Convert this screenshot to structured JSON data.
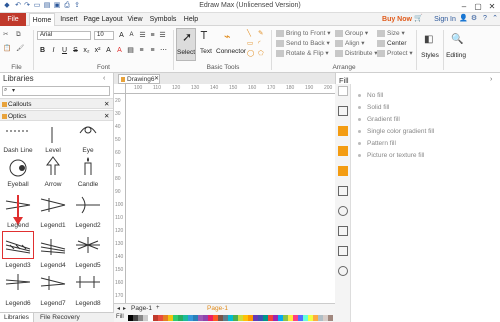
{
  "window": {
    "title": "Edraw Max (Unlicensed Version)"
  },
  "menu": {
    "tabs": [
      "File",
      "Home",
      "Insert",
      "Page Layout",
      "View",
      "Symbols",
      "Help"
    ],
    "buy_now": "Buy Now",
    "sign_in": "Sign In"
  },
  "ribbon": {
    "font_name": "Arial",
    "font_size": "10",
    "group_file": "File",
    "group_font": "Font",
    "group_basic_tools": "Basic Tools",
    "group_arrange": "Arrange",
    "select_label": "Select",
    "text_label": "Text",
    "connector_label": "Connector",
    "bring_to_front": "Bring to Front",
    "send_to_back": "Send to Back",
    "rotate_flip": "Rotate & Flip",
    "group": "Group",
    "align": "Align",
    "distribute": "Distribute",
    "size": "Size",
    "center": "Center",
    "protect": "Protect",
    "styles": "Styles",
    "editing": "Editing"
  },
  "libraries": {
    "title": "Libraries",
    "categories": [
      "Callouts",
      "Optics"
    ],
    "shapes": [
      [
        "Dash Line",
        "Level",
        "Eye"
      ],
      [
        "Eyeball",
        "Arrow",
        "Candle"
      ],
      [
        "Legend",
        "Legend1",
        "Legend2"
      ],
      [
        "Legend3",
        "Legend4",
        "Legend5"
      ],
      [
        "Legend6",
        "Legend7",
        "Legend8"
      ]
    ]
  },
  "bottom_tabs": {
    "libraries": "Libraries",
    "file_recovery": "File Recovery"
  },
  "document": {
    "tab": "Drawing6",
    "page_tab": "Page-1",
    "page_tab_active": "Page-1",
    "fill_label": "Fill",
    "ruler_h": [
      "100",
      "110",
      "120",
      "130",
      "140",
      "150",
      "160",
      "170",
      "180",
      "190",
      "200"
    ],
    "ruler_v": [
      "20",
      "30",
      "40",
      "50",
      "60",
      "70",
      "80",
      "90",
      "100",
      "110",
      "120",
      "130",
      "140",
      "150",
      "160",
      "170"
    ]
  },
  "fill_panel": {
    "title": "Fill",
    "options": [
      "No fill",
      "Solid fill",
      "Gradient fill",
      "Single color gradient fill",
      "Pattern fill",
      "Picture or texture fill"
    ]
  },
  "colors": {
    "accent": "#c0392b",
    "buy_now": "#e05a1a",
    "selection": "#e03030",
    "orange_icon": "#f39c12"
  }
}
